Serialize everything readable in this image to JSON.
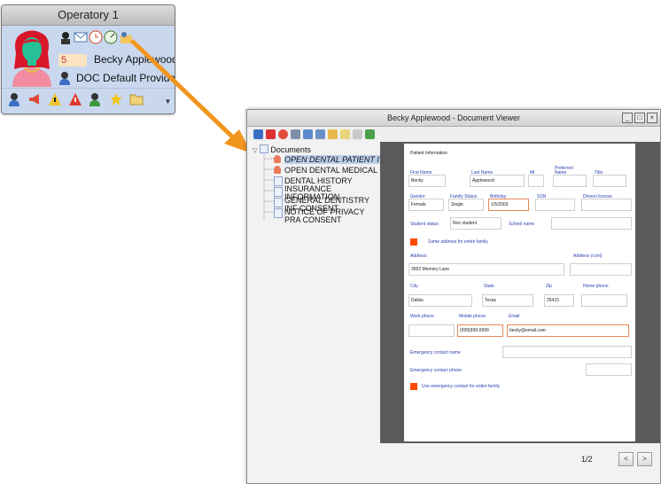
{
  "operatory": {
    "title": "Operatory 1",
    "appointment_number": "5",
    "patient_name": "Becky Applewood",
    "provider": "DOC Default Provider",
    "status_icons": [
      "incognito-icon",
      "mail-icon",
      "clock-icon",
      "gauge-icon",
      "person-chart-icon"
    ],
    "footer_icons": [
      "person-icon",
      "megaphone-icon",
      "warning-icon",
      "alert-icon",
      "person-arrow-icon",
      "star-icon",
      "folder-icon"
    ]
  },
  "viewer": {
    "title": "Becky Applewood - Document Viewer",
    "window_controls": [
      "minimize",
      "maximize",
      "close"
    ],
    "toolbar_icons": [
      "save-icon",
      "pdf-icon",
      "delete-icon",
      "print-icon",
      "copy-icon",
      "email-icon",
      "edit-icon",
      "note-icon",
      "arrow-icon",
      "export-icon"
    ],
    "tree": {
      "root": "Documents",
      "items": [
        "OPEN DENTAL PATIENT I",
        "OPEN DENTAL MEDICAL I",
        "DENTAL HISTORY",
        "INSURANCE INFORMATION",
        "GENERAL DENTISTRY INF CONSENT",
        "NOTICE OF PRIVACY PRA CONSENT"
      ]
    },
    "form": {
      "section": "Patient Information",
      "first_name_label": "First Name",
      "first_name": "Becky",
      "last_name_label": "Last Name",
      "last_name": "Applewood",
      "mi_label": "MI",
      "preferred_label": "Preferred Name",
      "title_label": "Title",
      "gender_label": "Gender",
      "gender": "Female",
      "family_status_label": "Family Status",
      "family_status": "Single",
      "birthday_label": "Birthday",
      "birthday": "1/5/2003",
      "ssn_label": "SSN",
      "drivers_license_label": "Drivers license",
      "student_status_label": "Student status",
      "student_status": "Non student",
      "school_name_label": "School name",
      "same_address_label": "Same address for entire family",
      "address_label": "Address",
      "address": "3652 Memory Lane",
      "address_cont_label": "Address (cont)",
      "city_label": "City",
      "city": "Dallas",
      "state_label": "State",
      "state": "Texas",
      "zip_label": "Zip",
      "zip": "25415",
      "home_phone_label": "Home phone",
      "work_phone_label": "Work phone",
      "mobile_phone_label": "Mobile phone",
      "mobile_phone": "(999)999-9999",
      "email_label": "Email",
      "email": "becky@email.com",
      "emergency_name_label": "Emergency contact name",
      "emergency_phone_label": "Emergency contact phone",
      "use_emergency_label": "Use emergency contact for entire family"
    },
    "pager": {
      "page_indicator": "1/2",
      "prev": "<",
      "next": ">"
    }
  },
  "colors": {
    "arrow": "#f0961f",
    "form_label": "#2b3fb5",
    "checkbox": "#ff4a00",
    "doc_background": "#5a5a5a",
    "operatory_body": "#c9d8ef"
  }
}
